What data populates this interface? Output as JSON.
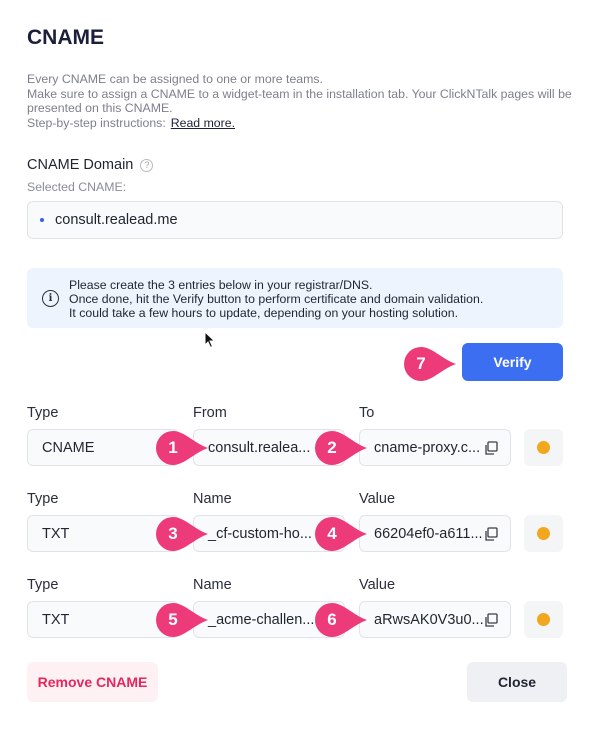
{
  "title": "CNAME",
  "description": {
    "line1": "Every CNAME can be assigned to one or more teams.",
    "line2": "Make sure to assign a CNAME to a widget-team in the installation tab. Your ClickNTalk pages will be presented on this CNAME.",
    "line3": "Step-by-step instructions:",
    "read_more": "Read more."
  },
  "domain": {
    "label": "CNAME Domain",
    "help_icon": "?",
    "selected_label": "Selected CNAME:",
    "value": "consult.realead.me"
  },
  "info": {
    "line1": "Please create the 3 entries below in your registrar/DNS.",
    "line2": "Once done, hit the Verify button to perform certificate and domain validation.",
    "line3": "It could take a few hours to update, depending on your hosting solution."
  },
  "verify_label": "Verify",
  "markers": [
    "1",
    "2",
    "3",
    "4",
    "5",
    "6",
    "7"
  ],
  "records": [
    {
      "labels": [
        "Type",
        "From",
        "To"
      ],
      "type": "CNAME",
      "name": "consult.realea...",
      "value": "cname-proxy.c..."
    },
    {
      "labels": [
        "Type",
        "Name",
        "Value"
      ],
      "type": "TXT",
      "name": "_cf-custom-ho...",
      "value": "66204ef0-a611..."
    },
    {
      "labels": [
        "Type",
        "Name",
        "Value"
      ],
      "type": "TXT",
      "name": "_acme-challen...",
      "value": "aRwsAK0V3u0..."
    }
  ],
  "status_color": "#f2a71e",
  "accent_color": "#3c6ef2",
  "marker_color": "#ec3b78",
  "remove_label": "Remove CNAME",
  "close_label": "Close"
}
